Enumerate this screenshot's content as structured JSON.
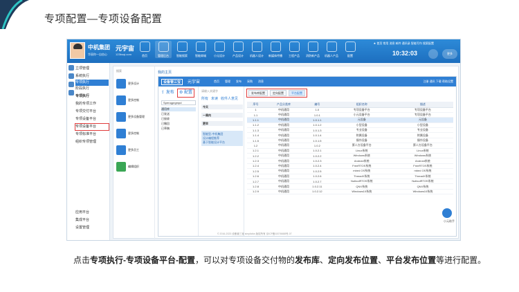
{
  "slide": {
    "title": "专项配置—专项设备配置",
    "caption_parts": [
      {
        "text": "点击",
        "bold": false
      },
      {
        "text": "专项执行-专项设备平台-配置",
        "bold": true
      },
      {
        "text": "，可以对专项设备交付物的",
        "bold": false
      },
      {
        "text": "发布库",
        "bold": true
      },
      {
        "text": "、",
        "bold": false
      },
      {
        "text": "定向发布位置",
        "bold": true
      },
      {
        "text": "、",
        "bold": false
      },
      {
        "text": "平台发布位置",
        "bold": true
      },
      {
        "text": "等进行配置。",
        "bold": false
      }
    ]
  },
  "topbar": {
    "company": "中机集团",
    "company_sub": "华丽你一自由心",
    "brand": "元宇宙",
    "brand_sub": "123boqi.com",
    "nav_items": [
      "首页",
      "管理后台",
      "智能搜索",
      "智能商城",
      "小元设计",
      "产品设计",
      "机器人设计",
      "新媒体传播",
      "工程产品",
      "消防新产品",
      "机器人产品",
      "配置"
    ],
    "active_nav": "管理后台",
    "util_links": "★ 首页 常用 消息 邮件 通讯录 智能写作 搜索配置",
    "clock": "10:32:03",
    "more": "更多"
  },
  "leftnav": {
    "items": [
      {
        "label": "立项管理",
        "style": ""
      },
      {
        "label": "系统执行",
        "style": ""
      },
      {
        "label": "专项执行",
        "style": "hl"
      },
      {
        "label": "阶段执行",
        "style": ""
      },
      {
        "label": "专项执行",
        "style": "head"
      },
      {
        "label": "我的专项工作",
        "style": ""
      },
      {
        "label": "专项交付平台",
        "style": ""
      },
      {
        "label": "专项设备平台",
        "style": ""
      },
      {
        "label": "专项设备平台",
        "style": "boxed"
      },
      {
        "label": "专项标准平台",
        "style": ""
      },
      {
        "label": "组织专项管理",
        "style": ""
      },
      {
        "label": "应用平台",
        "style": ""
      },
      {
        "label": "集成平台",
        "style": ""
      },
      {
        "label": "设置管理",
        "style": ""
      }
    ]
  },
  "workspace": {
    "search_placeholder": "搜索",
    "panel_title": "我的主页",
    "items": [
      {
        "label": "更多设计",
        "color": "blue"
      },
      {
        "label": "更多控制",
        "color": "blue"
      },
      {
        "label": "更多设备管理",
        "color": "blue"
      },
      {
        "label": "更多控制",
        "color": "blue"
      },
      {
        "label": "更多员工",
        "color": "blue"
      },
      {
        "label": "编辑组织",
        "color": "green"
      }
    ]
  },
  "inner": {
    "logo": "设备管三宝",
    "brand": "元宇宙",
    "menus": [
      "首页",
      "管理",
      "发布",
      "采购",
      "消息"
    ],
    "right": "注册 通讯 下载 帮助设置"
  },
  "publish": {
    "tab_publish": "发布",
    "tab_config": "配置",
    "select_value": "Sperogprgmpd",
    "tree": [
      "通用库",
      "已发送",
      "已接收",
      "已撤回",
      "已草稿"
    ]
  },
  "flow": {
    "search_placeholder": "请输入关键字",
    "tabs": [
      "所有",
      "未读",
      "收件人意见"
    ],
    "heads": [
      "今天",
      "一周内",
      "更早"
    ],
    "card_lines": [
      "智能型-中机集团",
      "设计编程推荐",
      "基于智能设计平台"
    ]
  },
  "main": {
    "buttons": [
      {
        "label": "发布库配置",
        "on": false
      },
      {
        "label": "定向配置",
        "on": false
      },
      {
        "label": "平台配置",
        "on": true
      }
    ],
    "columns": [
      "序号",
      "产品分类库",
      "编号",
      "组织名称",
      "描述"
    ],
    "rows": [
      {
        "no": "1",
        "cat": "中机通用",
        "code": "1.0",
        "name": "专项设备平台",
        "desc": "专项设备平台",
        "hl": false
      },
      {
        "no": "1.1",
        "cat": "中机通用",
        "code": "1.0.1",
        "name": "小元设备平台",
        "desc": "专项设备平台",
        "hl": false
      },
      {
        "no": "1.1.1",
        "cat": "中机通用",
        "code": "1.0.1.1",
        "name": "元设备",
        "desc": "元设备",
        "hl": true
      },
      {
        "no": "1.1.2",
        "cat": "中机通用",
        "code": "1.0.1.2",
        "name": "小型设备",
        "desc": "小型设备",
        "hl": false
      },
      {
        "no": "1.1.3",
        "cat": "中机通用",
        "code": "1.0.1.3",
        "name": "专业设备",
        "desc": "专业设备",
        "hl": false
      },
      {
        "no": "1.1.4",
        "cat": "中机通用",
        "code": "1.0.1.4",
        "name": "附属设备",
        "desc": "附属设备",
        "hl": false
      },
      {
        "no": "1.1.5",
        "cat": "中机通用",
        "code": "1.0.1.5",
        "name": "操作设备",
        "desc": "操作设备",
        "hl": false
      },
      {
        "no": "1.2",
        "cat": "中机通用",
        "code": "1.0.2",
        "name": "第二方设备平台",
        "desc": "第二方设备平台",
        "hl": false
      },
      {
        "no": "1.2.1",
        "cat": "中机通用",
        "code": "1.0.2.1",
        "name": "Linux系统",
        "desc": "Linux系统",
        "hl": false
      },
      {
        "no": "1.2.2",
        "cat": "中机通用",
        "code": "1.0.2.2",
        "name": "Windows系统",
        "desc": "Windows系统",
        "hl": false
      },
      {
        "no": "1.2.3",
        "cat": "中机通用",
        "code": "1.0.2.3",
        "name": "Android系统",
        "desc": "Android系统",
        "hl": false
      },
      {
        "no": "1.2.4",
        "cat": "中机通用",
        "code": "1.0.2.4",
        "name": "FreeRTOS系统",
        "desc": "FreeRTOS系统",
        "hl": false
      },
      {
        "no": "1.2.5",
        "cat": "中机通用",
        "code": "1.0.2.5",
        "name": "mbed OS系统",
        "desc": "mbed OS系统",
        "hl": false
      },
      {
        "no": "1.2.6",
        "cat": "中机通用",
        "code": "1.0.2.6",
        "name": "ThreadX系统",
        "desc": "ThreadX系统",
        "hl": false
      },
      {
        "no": "1.2.7",
        "cat": "中机通用",
        "code": "1.0.2.7",
        "name": "NuttxolRTOS系统",
        "desc": "NuttxolRTOS系统",
        "hl": false
      },
      {
        "no": "1.2.8",
        "cat": "中机通用",
        "code": "1.0.2.11",
        "name": "QNX系统",
        "desc": "QNX系统",
        "hl": false
      },
      {
        "no": "1.2.9",
        "cat": "中机通用",
        "code": "1.0.2.12",
        "name": "Windows10系统",
        "desc": "Windows10系统",
        "hl": false
      }
    ],
    "footer": "© 2016-2023 设备管三宝 simplicitw 版权所有 京ICP备10076688号-07",
    "help": "小元助手"
  }
}
